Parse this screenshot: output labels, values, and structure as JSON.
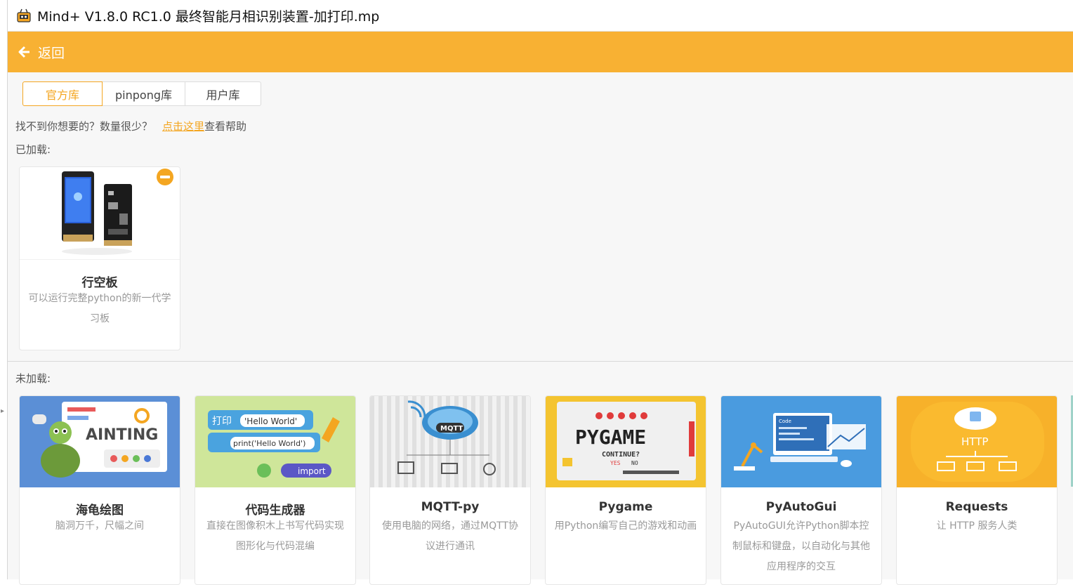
{
  "window": {
    "title": "Mind+ V1.8.0 RC1.0   最终智能月相识别装置-加打印.mp"
  },
  "header": {
    "back_label": "返回"
  },
  "tabs": [
    {
      "label": "官方库",
      "active": true
    },
    {
      "label": "pinpong库",
      "active": false
    },
    {
      "label": "用户库",
      "active": false
    }
  ],
  "hint": {
    "text": "找不到你想要的？数量很少？",
    "link": "点击这里",
    "suffix": "查看帮助"
  },
  "loaded": {
    "label": "已加载:",
    "items": [
      {
        "name": "行空板",
        "desc": "可以运行完整python的新一代学习板"
      }
    ]
  },
  "unloaded": {
    "label": "未加载:",
    "items": [
      {
        "name": "海龟绘图",
        "desc": "脑洞万千，尺幅之间",
        "img_text": "AINTING"
      },
      {
        "name": "代码生成器",
        "desc": "直接在图像积木上书写代码实现图形化与代码混编",
        "img_texts": [
          "打印",
          "'Hello World'",
          "print('Hello World')",
          "import"
        ]
      },
      {
        "name": "MQTT-py",
        "desc": "使用电脑的网络，通过MQTT协议进行通讯",
        "img_text": "MQTT"
      },
      {
        "name": "Pygame",
        "desc": "用Python编写自己的游戏和动画",
        "img_texts": [
          "PYGAME",
          "CONTINUE?",
          "YES",
          "NO"
        ]
      },
      {
        "name": "PyAutoGui",
        "desc": "PyAutoGUI允许Python脚本控制鼠标和键盘，以自动化与其他应用程序的交互",
        "img_text": "Code"
      },
      {
        "name": "Requests",
        "desc": "让 HTTP 服务人类",
        "img_text": "HTTP"
      }
    ]
  },
  "colors": {
    "accent": "#f8b133",
    "link": "#f4a621",
    "background": "#f7f7f7"
  }
}
